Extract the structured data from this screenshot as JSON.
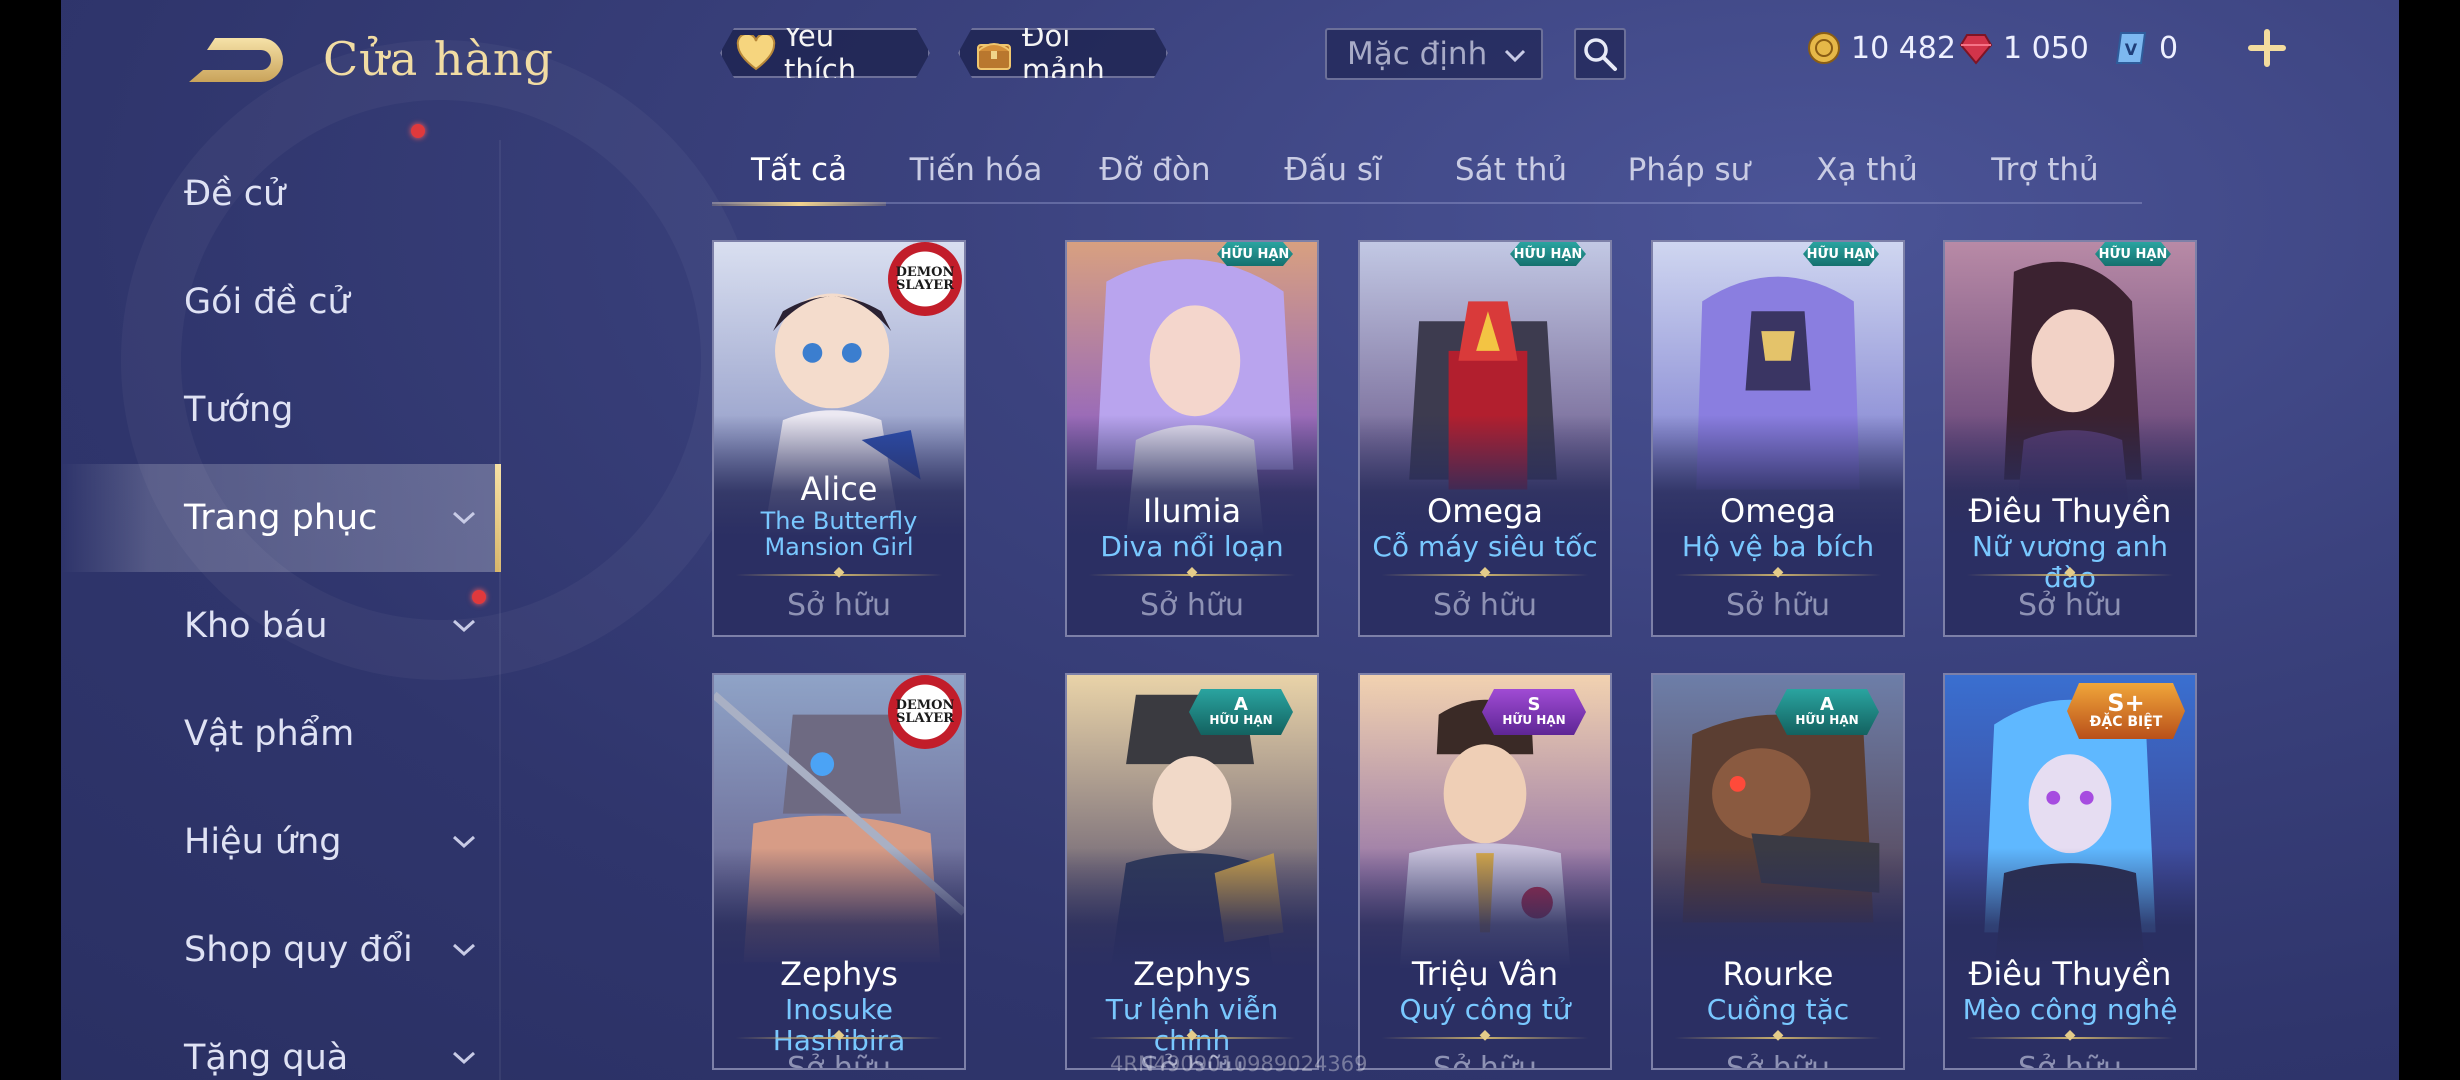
{
  "header": {
    "title": "Cửa hàng",
    "favorite_label": "Yêu thích",
    "exchange_label": "Đổi mảnh",
    "sort_value": "Mặc định"
  },
  "currency": {
    "gold": "10 482",
    "ruby": "1 050",
    "voucher": "0"
  },
  "sidebar": {
    "items": [
      {
        "label": "Đề cử"
      },
      {
        "label": "Gói đề cử"
      },
      {
        "label": "Tướng"
      },
      {
        "label": "Trang phục"
      },
      {
        "label": "Kho báu"
      },
      {
        "label": "Vật phẩm"
      },
      {
        "label": "Hiệu ứng"
      },
      {
        "label": "Shop quy đổi"
      },
      {
        "label": "Tặng quà"
      }
    ]
  },
  "tabs": [
    "Tất cả",
    "Tiến hóa",
    "Đỡ đòn",
    "Đấu sĩ",
    "Sát thủ",
    "Pháp sư",
    "Xạ thủ",
    "Trợ thủ"
  ],
  "cards": [
    {
      "hero": "Alice",
      "skin": "The Butterfly Mansion Girl",
      "status": "Sở hữu",
      "collab": "DEMON SLAYER"
    },
    {
      "hero": "Ilumia",
      "skin": "Diva nổi loạn",
      "status": "Sở hữu",
      "badge": "HỮU HẠN"
    },
    {
      "hero": "Omega",
      "skin": "Cỗ máy siêu tốc",
      "status": "Sở hữu",
      "badge": "HỮU HẠN"
    },
    {
      "hero": "Omega",
      "skin": "Hộ vệ ba bích",
      "status": "Sở hữu",
      "badge": "HỮU HẠN"
    },
    {
      "hero": "Điêu Thuyền",
      "skin": "Nữ vương anh đào",
      "status": "Sở hữu",
      "badge": "HỮU HẠN"
    },
    {
      "hero": "Zephys",
      "skin": "Inosuke Hashibira",
      "status": "Sở hữu",
      "collab": "DEMON SLAYER"
    },
    {
      "hero": "Zephys",
      "skin": "Tư lệnh viễn chinh",
      "status": "Sở hữu",
      "tier": "A",
      "badge": "HỮU HẠN"
    },
    {
      "hero": "Triệu Vân",
      "skin": "Quý công tử",
      "status": "Sở hữu",
      "tier": "S",
      "badge": "HỮU HẠN"
    },
    {
      "hero": "Rourke",
      "skin": "Cuồng tặc",
      "status": "Sở hữu",
      "tier": "A",
      "badge": "HỮU HẠN"
    },
    {
      "hero": "Điêu Thuyền",
      "skin": "Mèo công nghệ",
      "status": "Sở hữu",
      "tier": "S+",
      "badge": "ĐẶC BIỆT"
    }
  ],
  "watermark": "4RN4909010989024369",
  "colors": {
    "background": "#3b427e",
    "title_gold": "#f1dca3",
    "skin_name_blue": "#79c8ff",
    "notification_red": "#e0393c"
  }
}
